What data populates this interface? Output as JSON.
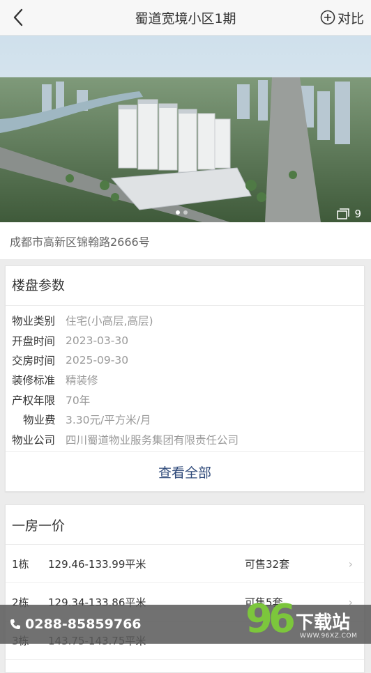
{
  "header": {
    "title": "蜀道宽境小区1期",
    "compare_label": "对比"
  },
  "gallery": {
    "photo_count": "9",
    "pages": 2,
    "current_page": 1
  },
  "address": "成都市高新区锦翰路2666号",
  "params": {
    "section_title": "楼盘参数",
    "items": [
      {
        "label": "物业类别",
        "value": "住宅(小高层,高层)"
      },
      {
        "label": "开盘时间",
        "value": "2023-03-30"
      },
      {
        "label": "交房时间",
        "value": "2025-09-30"
      },
      {
        "label": "装修标准",
        "value": "精装修"
      },
      {
        "label": "产权年限",
        "value": "70年"
      },
      {
        "label": "物业费",
        "value": "3.30元/平方米/月"
      },
      {
        "label": "物业公司",
        "value": "四川蜀道物业服务集团有限责任公司"
      }
    ],
    "view_all_label": "查看全部"
  },
  "prices": {
    "section_title": "一房一价",
    "rows": [
      {
        "building": "1栋",
        "area": "129.46-133.99平米",
        "available": "可售32套"
      },
      {
        "building": "2栋",
        "area": "129.34-133.86平米",
        "available": "可售5套"
      },
      {
        "building": "3栋",
        "area": "143.75-143.75平米",
        "available": ""
      }
    ]
  },
  "contact": {
    "phone": "0288-85859766"
  },
  "watermark": {
    "digits": "96",
    "name": "下载站",
    "url": "WWW.96XZ.COM"
  },
  "colors": {
    "link": "#2f4a7a",
    "watermark_green": "#7cc63c",
    "watermark_orange": "#f0a51d"
  }
}
